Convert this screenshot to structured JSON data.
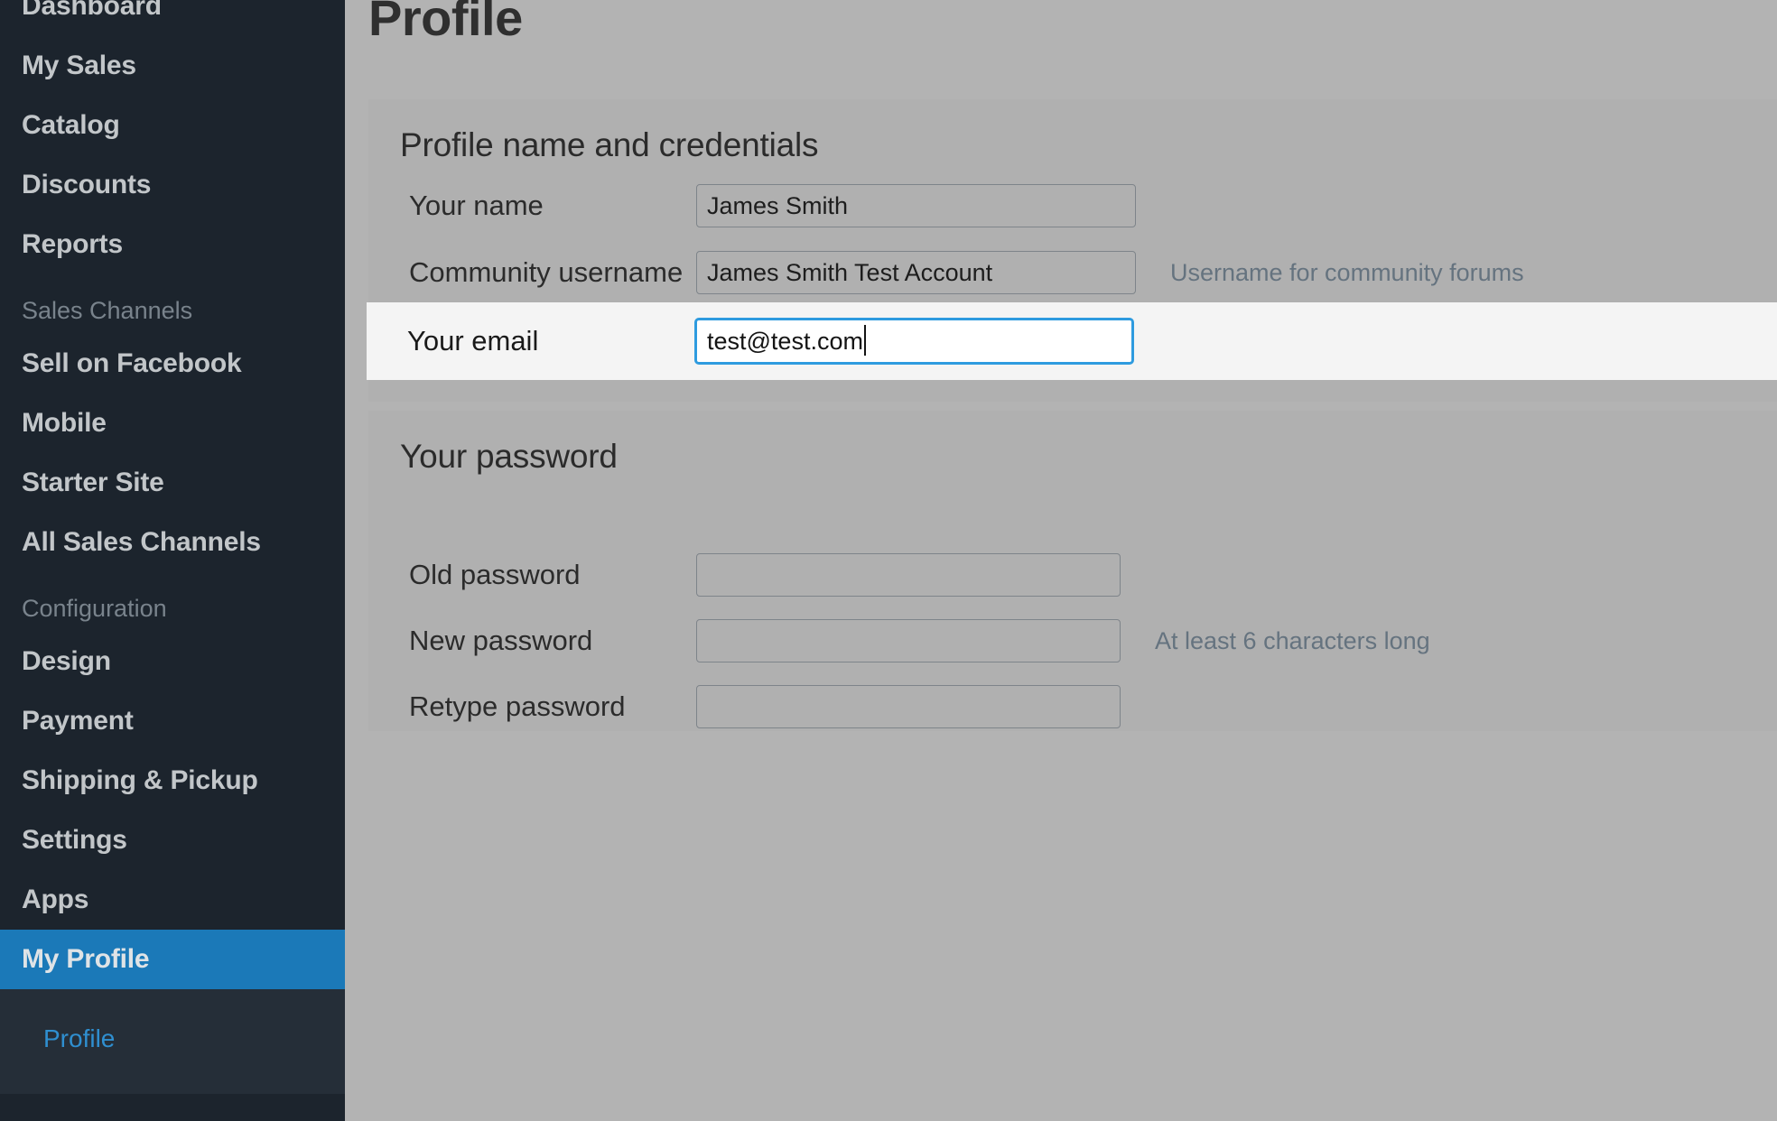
{
  "sidebar": {
    "items": [
      {
        "label": "Dashboard",
        "type": "item",
        "active": false
      },
      {
        "label": "My Sales",
        "type": "item",
        "active": false
      },
      {
        "label": "Catalog",
        "type": "item",
        "active": false
      },
      {
        "label": "Discounts",
        "type": "item",
        "active": false
      },
      {
        "label": "Reports",
        "type": "item",
        "active": false
      },
      {
        "label": "Sales Channels",
        "type": "section",
        "active": false
      },
      {
        "label": "Sell on Facebook",
        "type": "item",
        "active": false
      },
      {
        "label": "Mobile",
        "type": "item",
        "active": false
      },
      {
        "label": "Starter Site",
        "type": "item",
        "active": false
      },
      {
        "label": "All Sales Channels",
        "type": "item",
        "active": false
      },
      {
        "label": "Configuration",
        "type": "section",
        "active": false
      },
      {
        "label": "Design",
        "type": "item",
        "active": false
      },
      {
        "label": "Payment",
        "type": "item",
        "active": false
      },
      {
        "label": "Shipping & Pickup",
        "type": "item",
        "active": false
      },
      {
        "label": "Settings",
        "type": "item",
        "active": false
      },
      {
        "label": "Apps",
        "type": "item",
        "active": false
      },
      {
        "label": "My Profile",
        "type": "item",
        "active": true
      }
    ],
    "subnav": [
      {
        "label": "Profile"
      }
    ],
    "colors": {
      "background": "#1c242d",
      "active_background": "#1b79b8",
      "subnav_background": "#252e38",
      "item_text": "#c2c6c9",
      "section_text": "#79838c",
      "subnav_link": "#2f8fd0"
    }
  },
  "main": {
    "page_title": "Profile",
    "colors": {
      "page_background": "#b3b3b3",
      "panel_background": "#b0b0b0",
      "focus_row_background": "#f4f4f4",
      "focus_border": "#2e9bdf",
      "hint_text": "#65737f"
    },
    "sections": [
      {
        "heading": "Profile name and credentials",
        "fields": [
          {
            "label": "Your name",
            "value": "James Smith",
            "hint": "",
            "focused": false
          },
          {
            "label": "Community username",
            "value": "James Smith Test Account",
            "hint": "Username for community forums",
            "focused": false
          },
          {
            "label": "Your email",
            "value": "test@test.com",
            "hint": "",
            "focused": true
          }
        ]
      },
      {
        "heading": "Your password",
        "fields": [
          {
            "label": "Old password",
            "value": "",
            "hint": "",
            "focused": false
          },
          {
            "label": "New password",
            "value": "",
            "hint": "At least 6 characters long",
            "focused": false
          },
          {
            "label": "Retype password",
            "value": "",
            "hint": "",
            "focused": false
          }
        ]
      }
    ]
  }
}
